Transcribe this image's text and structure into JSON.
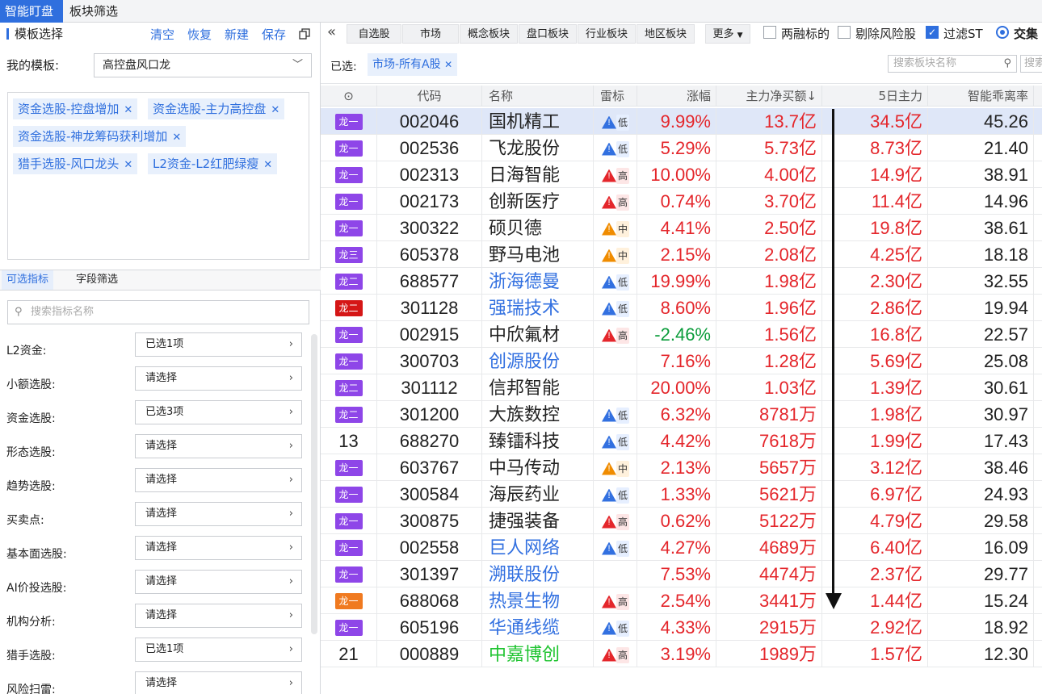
{
  "top_tabs": [
    "智能盯盘",
    "板块筛选"
  ],
  "left": {
    "header_title": "模板选择",
    "actions": [
      "清空",
      "恢复",
      "新建",
      "保存"
    ],
    "my_template_label": "我的模板:",
    "my_template_value": "高控盘风口龙",
    "tags": [
      "资金选股-控盘增加",
      "资金选股-主力高控盘",
      "资金选股-神龙筹码获利增加",
      "猎手选股-风口龙头",
      "L2资金-L2红肥绿瘦"
    ],
    "sub_tabs": [
      "可选指标",
      "字段筛选"
    ],
    "search_placeholder": "搜索指标名称",
    "indicators": [
      {
        "label": "L2资金:",
        "value": "已选1项"
      },
      {
        "label": "小额选股:",
        "value": "请选择"
      },
      {
        "label": "资金选股:",
        "value": "已选3项"
      },
      {
        "label": "形态选股:",
        "value": "请选择"
      },
      {
        "label": "趋势选股:",
        "value": "请选择"
      },
      {
        "label": "买卖点:",
        "value": "请选择"
      },
      {
        "label": "基本面选股:",
        "value": "请选择"
      },
      {
        "label": "AI价投选股:",
        "value": "请选择"
      },
      {
        "label": "机构分析:",
        "value": "请选择"
      },
      {
        "label": "猎手选股:",
        "value": "已选1项"
      },
      {
        "label": "风险扫雷:",
        "value": "请选择"
      }
    ]
  },
  "toolbar": {
    "collapse": "«",
    "buttons": [
      "自选股",
      "市场",
      "概念板块",
      "盘口板块",
      "行业板块",
      "地区板块",
      "更多"
    ],
    "more_icon": "caret-down-icon",
    "checks": [
      {
        "label": "两融标的",
        "checked": false
      },
      {
        "label": "剔除风险股",
        "checked": false
      },
      {
        "label": "过滤ST",
        "checked": true
      }
    ],
    "radio_label": "交集"
  },
  "selected": {
    "label": "已选:",
    "tag": "市场-所有A股",
    "search_placeholder": "搜索板块名称",
    "search2_placeholder": "搜索"
  },
  "table": {
    "headers": [
      "代码",
      "名称",
      "雷标",
      "涨幅",
      "主力净买额↓",
      "5日主力",
      "智能乖离率"
    ],
    "rows": [
      {
        "rank": "龙一",
        "badge_color": "#8e46e8",
        "code": "002046",
        "name": "国机精工",
        "name_color": "black",
        "risk": "低",
        "change": "9.99%",
        "net": "13.7亿",
        "five": "34.5亿",
        "bias": "45.26"
      },
      {
        "rank": "龙一",
        "badge_color": "#8e46e8",
        "code": "002536",
        "name": "飞龙股份",
        "name_color": "black",
        "risk": "低",
        "change": "5.29%",
        "net": "5.73亿",
        "five": "8.73亿",
        "bias": "21.40"
      },
      {
        "rank": "龙一",
        "badge_color": "#8e46e8",
        "code": "002313",
        "name": "日海智能",
        "name_color": "black",
        "risk": "高",
        "change": "10.00%",
        "net": "4.00亿",
        "five": "14.9亿",
        "bias": "38.91"
      },
      {
        "rank": "龙一",
        "badge_color": "#8e46e8",
        "code": "002173",
        "name": "创新医疗",
        "name_color": "black",
        "risk": "高",
        "change": "0.74%",
        "net": "3.70亿",
        "five": "11.4亿",
        "bias": "14.96"
      },
      {
        "rank": "龙一",
        "badge_color": "#8e46e8",
        "code": "300322",
        "name": "硕贝德",
        "name_color": "black",
        "risk": "中",
        "change": "4.41%",
        "net": "2.50亿",
        "five": "19.8亿",
        "bias": "38.61"
      },
      {
        "rank": "龙三",
        "badge_color": "#8e46e8",
        "code": "605378",
        "name": "野马电池",
        "name_color": "black",
        "risk": "中",
        "change": "2.15%",
        "net": "2.08亿",
        "five": "4.25亿",
        "bias": "18.18"
      },
      {
        "rank": "龙二",
        "badge_color": "#8e46e8",
        "code": "688577",
        "name": "浙海德曼",
        "name_color": "blue",
        "risk": "低",
        "change": "19.99%",
        "net": "1.98亿",
        "five": "2.30亿",
        "bias": "32.55"
      },
      {
        "rank": "龙二",
        "badge_color": "#d51616",
        "code": "301128",
        "name": "强瑞技术",
        "name_color": "blue",
        "risk": "低",
        "change": "8.60%",
        "net": "1.96亿",
        "five": "2.86亿",
        "bias": "19.94"
      },
      {
        "rank": "龙一",
        "badge_color": "#8e46e8",
        "code": "002915",
        "name": "中欣氟材",
        "name_color": "black",
        "risk": "高",
        "change": "-2.46%",
        "net": "1.56亿",
        "five": "16.8亿",
        "bias": "22.57"
      },
      {
        "rank": "龙一",
        "badge_color": "#8e46e8",
        "code": "300703",
        "name": "创源股份",
        "name_color": "blue",
        "risk": "",
        "change": "7.16%",
        "net": "1.28亿",
        "five": "5.69亿",
        "bias": "25.08"
      },
      {
        "rank": "龙二",
        "badge_color": "#8e46e8",
        "code": "301112",
        "name": "信邦智能",
        "name_color": "black",
        "risk": "",
        "change": "20.00%",
        "net": "1.03亿",
        "five": "1.39亿",
        "bias": "30.61"
      },
      {
        "rank": "龙二",
        "badge_color": "#8e46e8",
        "code": "301200",
        "name": "大族数控",
        "name_color": "black",
        "risk": "低",
        "change": "6.32%",
        "net": "8781万",
        "five": "1.98亿",
        "bias": "30.97"
      },
      {
        "rank": "13",
        "badge_color": "",
        "code": "688270",
        "name": "臻镭科技",
        "name_color": "black",
        "risk": "低",
        "change": "4.42%",
        "net": "7618万",
        "five": "1.99亿",
        "bias": "17.43"
      },
      {
        "rank": "龙一",
        "badge_color": "#8e46e8",
        "code": "603767",
        "name": "中马传动",
        "name_color": "black",
        "risk": "中",
        "change": "2.13%",
        "net": "5657万",
        "five": "3.12亿",
        "bias": "38.46"
      },
      {
        "rank": "龙一",
        "badge_color": "#8e46e8",
        "code": "300584",
        "name": "海辰药业",
        "name_color": "black",
        "risk": "低",
        "change": "1.33%",
        "net": "5621万",
        "five": "6.97亿",
        "bias": "24.93"
      },
      {
        "rank": "龙一",
        "badge_color": "#8e46e8",
        "code": "300875",
        "name": "捷强装备",
        "name_color": "black",
        "risk": "高",
        "change": "0.62%",
        "net": "5122万",
        "five": "4.79亿",
        "bias": "29.58"
      },
      {
        "rank": "龙一",
        "badge_color": "#8e46e8",
        "code": "002558",
        "name": "巨人网络",
        "name_color": "blue",
        "risk": "低",
        "change": "4.27%",
        "net": "4689万",
        "five": "6.40亿",
        "bias": "16.09"
      },
      {
        "rank": "龙一",
        "badge_color": "#8e46e8",
        "code": "301397",
        "name": "溯联股份",
        "name_color": "blue",
        "risk": "",
        "change": "7.53%",
        "net": "4474万",
        "five": "2.37亿",
        "bias": "29.77"
      },
      {
        "rank": "龙一",
        "badge_color": "#f07a20",
        "code": "688068",
        "name": "热景生物",
        "name_color": "blue",
        "risk": "高",
        "change": "2.54%",
        "net": "3441万",
        "five": "1.44亿",
        "bias": "15.24"
      },
      {
        "rank": "龙一",
        "badge_color": "#8e46e8",
        "code": "605196",
        "name": "华通线缆",
        "name_color": "blue",
        "risk": "低",
        "change": "4.33%",
        "net": "2915万",
        "five": "2.92亿",
        "bias": "18.92"
      },
      {
        "rank": "21",
        "badge_color": "",
        "code": "000889",
        "name": "中嘉博创",
        "name_color": "lime",
        "risk": "高",
        "change": "3.19%",
        "net": "1989万",
        "five": "1.57亿",
        "bias": "12.30"
      }
    ]
  },
  "colors": {
    "accent": "#2f6fde",
    "up": "#e4262b",
    "down": "#0a9c3a",
    "risk_low": "#3270e0",
    "risk_mid": "#f08c00",
    "risk_high": "#e4262b"
  }
}
